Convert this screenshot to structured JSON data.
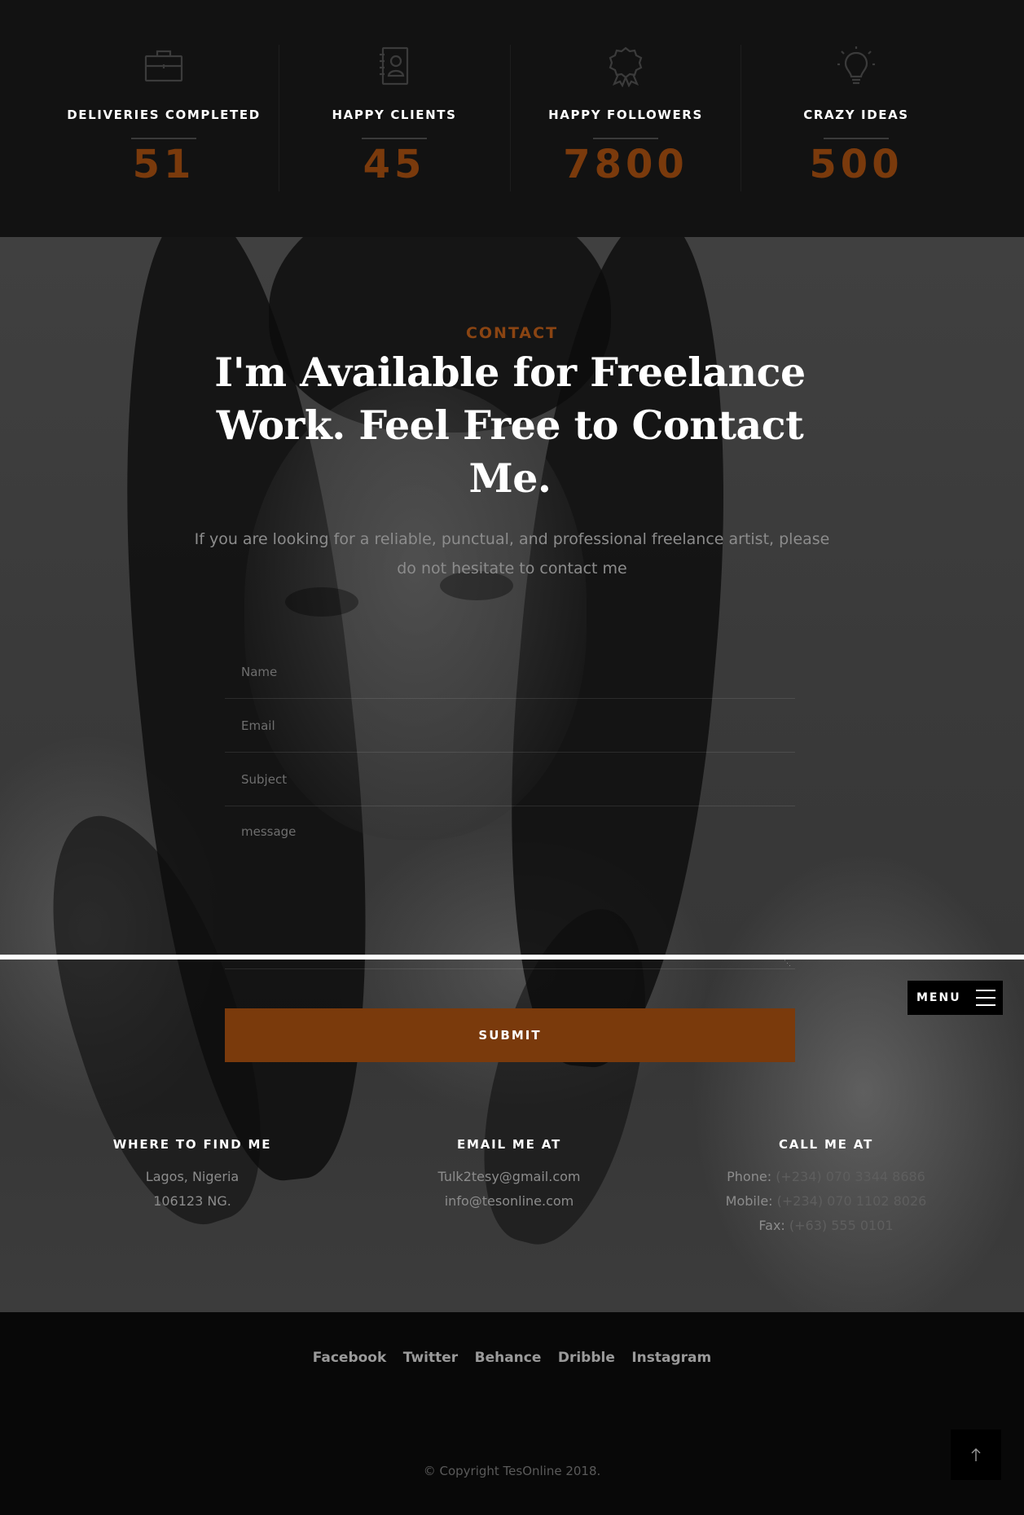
{
  "stats": [
    {
      "icon": "briefcase-icon",
      "label": "DELIVERIES COMPLETED",
      "value": "51"
    },
    {
      "icon": "contact-book-icon",
      "label": "HAPPY CLIENTS",
      "value": "45"
    },
    {
      "icon": "badge-ribbon-icon",
      "label": "HAPPY FOLLOWERS",
      "value": "7800"
    },
    {
      "icon": "lightbulb-icon",
      "label": "CRAZY IDEAS",
      "value": "500"
    }
  ],
  "contact": {
    "kicker": "CONTACT",
    "headline": "I'm Available for Freelance Work. Feel Free to Contact Me.",
    "lead": "If you are looking for a reliable, punctual, and professional freelance artist, please do not hesitate to contact me",
    "form": {
      "name_placeholder": "Name",
      "email_placeholder": "Email",
      "subject_placeholder": "Subject",
      "message_placeholder": "message",
      "submit_label": "SUBMIT"
    },
    "info": {
      "where": {
        "title": "WHERE TO FIND ME",
        "lines": [
          "Lagos, Nigeria",
          "106123 NG."
        ]
      },
      "email": {
        "title": "EMAIL ME AT",
        "lines": [
          "Tulk2tesy@gmail.com",
          "info@tesonline.com"
        ]
      },
      "call": {
        "title": "CALL ME AT",
        "lines": [
          {
            "key": "Phone:",
            "value": "(+234) 070 3344 8686"
          },
          {
            "key": "Mobile:",
            "value": "(+234) 070 1102 8026"
          },
          {
            "key": "Fax:",
            "value": "(+63) 555 0101"
          }
        ]
      }
    }
  },
  "menu": {
    "label": "MENU"
  },
  "footer": {
    "social": [
      "Facebook",
      "Twitter",
      "Behance",
      "Dribble",
      "Instagram"
    ],
    "copyright": "© Copyright TesOnline 2018."
  },
  "colors": {
    "accent": "#7a3a0c",
    "stats_bg": "#121212",
    "footer_bg": "#080808"
  }
}
